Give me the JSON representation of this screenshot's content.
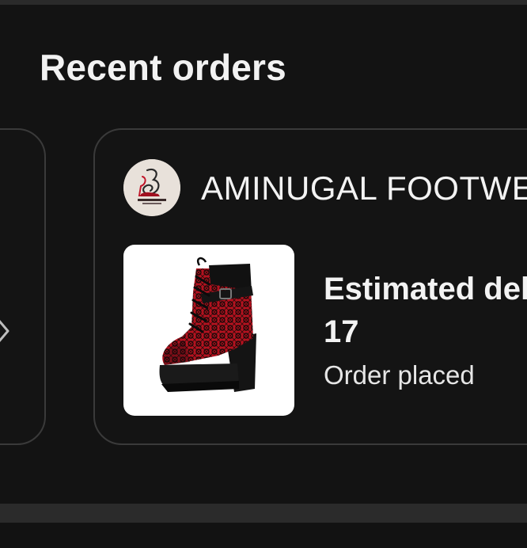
{
  "section": {
    "title": "Recent orders"
  },
  "previous_card": {
    "arrow_icon": "chevron-right-icon"
  },
  "order": {
    "store_name": "AMINUGAL FOOTWEAR",
    "store_logo_icon": "store-logo-icon",
    "store_logo_text": "AMINUGAL",
    "product_image_icon": "boot-icon",
    "delivery_label": "Estimated delivery",
    "delivery_date": "17",
    "status": "Order placed"
  },
  "colors": {
    "background": "#131313",
    "card_border": "#3a3a3a",
    "text": "#f3f3f3",
    "boot_red": "#c0162a"
  }
}
